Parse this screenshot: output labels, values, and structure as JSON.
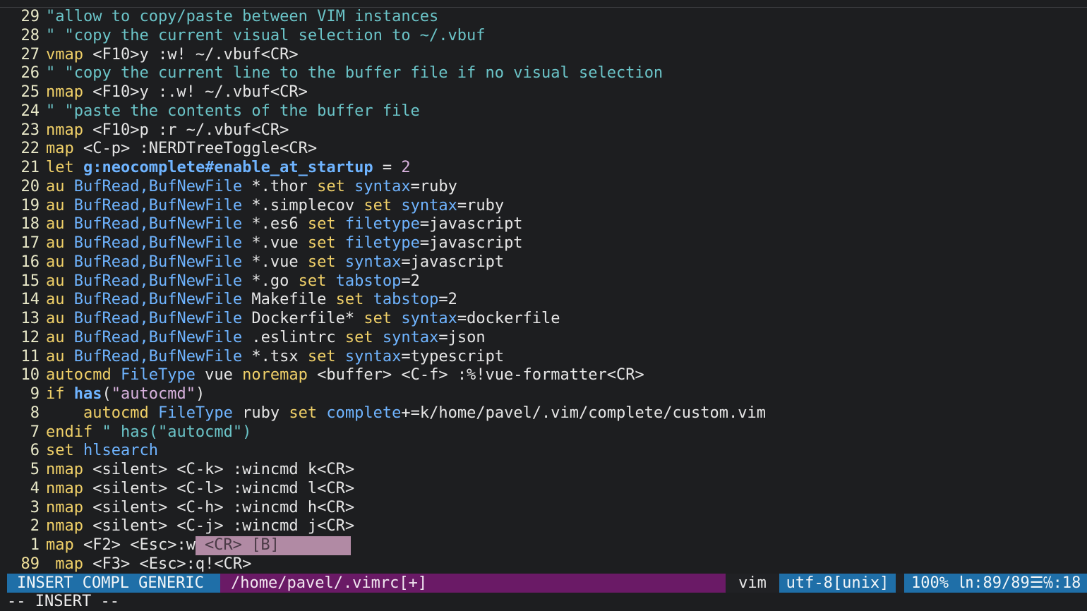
{
  "editor": {
    "lines": [
      {
        "num": "29",
        "segments": [
          {
            "t": "\"allow to copy/paste between VIM instances",
            "c": "t-comment"
          }
        ]
      },
      {
        "num": "28",
        "segments": [
          {
            "t": "\" \"copy the current visual selection to ~/.vbuf",
            "c": "t-comment"
          }
        ]
      },
      {
        "num": "27",
        "segments": [
          {
            "t": "vmap",
            "c": "t-kw"
          },
          {
            "t": " <F10>y :w! ~/.vbuf<CR>",
            "c": "t-plain"
          }
        ]
      },
      {
        "num": "26",
        "segments": [
          {
            "t": "\" \"copy the current line to the buffer file if no visual selection",
            "c": "t-comment"
          }
        ]
      },
      {
        "num": "25",
        "segments": [
          {
            "t": "nmap",
            "c": "t-kw"
          },
          {
            "t": " <F10>y :.w! ~/.vbuf<CR>",
            "c": "t-plain"
          }
        ]
      },
      {
        "num": "24",
        "segments": [
          {
            "t": "\" \"paste the contents of the buffer file",
            "c": "t-comment"
          }
        ]
      },
      {
        "num": "23",
        "segments": [
          {
            "t": "nmap",
            "c": "t-kw"
          },
          {
            "t": " <F10>p :r ~/.vbuf<CR>",
            "c": "t-plain"
          }
        ]
      },
      {
        "num": "22",
        "segments": [
          {
            "t": "map",
            "c": "t-kw"
          },
          {
            "t": " <C-p> :NERDTreeToggle<CR>",
            "c": "t-plain"
          }
        ]
      },
      {
        "num": "21",
        "segments": [
          {
            "t": "let",
            "c": "t-kw"
          },
          {
            "t": " ",
            "c": "t-plain"
          },
          {
            "t": "g:neocomplete#enable_at_startup",
            "c": "t-bold-blue"
          },
          {
            "t": " = ",
            "c": "t-plain"
          },
          {
            "t": "2",
            "c": "t-num"
          }
        ]
      },
      {
        "num": "20",
        "segments": [
          {
            "t": "au",
            "c": "t-kw"
          },
          {
            "t": " ",
            "c": "t-plain"
          },
          {
            "t": "BufRead,BufNewFile",
            "c": "t-var"
          },
          {
            "t": " *.thor ",
            "c": "t-plain"
          },
          {
            "t": "set",
            "c": "t-kw"
          },
          {
            "t": " ",
            "c": "t-plain"
          },
          {
            "t": "syntax",
            "c": "t-var"
          },
          {
            "t": "=ruby",
            "c": "t-plain"
          }
        ]
      },
      {
        "num": "19",
        "segments": [
          {
            "t": "au",
            "c": "t-kw"
          },
          {
            "t": " ",
            "c": "t-plain"
          },
          {
            "t": "BufRead,BufNewFile",
            "c": "t-var"
          },
          {
            "t": " *.simplecov ",
            "c": "t-plain"
          },
          {
            "t": "set",
            "c": "t-kw"
          },
          {
            "t": " ",
            "c": "t-plain"
          },
          {
            "t": "syntax",
            "c": "t-var"
          },
          {
            "t": "=ruby",
            "c": "t-plain"
          }
        ]
      },
      {
        "num": "18",
        "segments": [
          {
            "t": "au",
            "c": "t-kw"
          },
          {
            "t": " ",
            "c": "t-plain"
          },
          {
            "t": "BufRead,BufNewFile",
            "c": "t-var"
          },
          {
            "t": " *.es6 ",
            "c": "t-plain"
          },
          {
            "t": "set",
            "c": "t-kw"
          },
          {
            "t": " ",
            "c": "t-plain"
          },
          {
            "t": "filetype",
            "c": "t-var"
          },
          {
            "t": "=javascript",
            "c": "t-plain"
          }
        ]
      },
      {
        "num": "17",
        "segments": [
          {
            "t": "au",
            "c": "t-kw"
          },
          {
            "t": " ",
            "c": "t-plain"
          },
          {
            "t": "BufRead,BufNewFile",
            "c": "t-var"
          },
          {
            "t": " *.vue ",
            "c": "t-plain"
          },
          {
            "t": "set",
            "c": "t-kw"
          },
          {
            "t": " ",
            "c": "t-plain"
          },
          {
            "t": "filetype",
            "c": "t-var"
          },
          {
            "t": "=javascript",
            "c": "t-plain"
          }
        ]
      },
      {
        "num": "16",
        "segments": [
          {
            "t": "au",
            "c": "t-kw"
          },
          {
            "t": " ",
            "c": "t-plain"
          },
          {
            "t": "BufRead,BufNewFile",
            "c": "t-var"
          },
          {
            "t": " *.vue ",
            "c": "t-plain"
          },
          {
            "t": "set",
            "c": "t-kw"
          },
          {
            "t": " ",
            "c": "t-plain"
          },
          {
            "t": "syntax",
            "c": "t-var"
          },
          {
            "t": "=javascript",
            "c": "t-plain"
          }
        ]
      },
      {
        "num": "15",
        "segments": [
          {
            "t": "au",
            "c": "t-kw"
          },
          {
            "t": " ",
            "c": "t-plain"
          },
          {
            "t": "BufRead,BufNewFile",
            "c": "t-var"
          },
          {
            "t": " *.go ",
            "c": "t-plain"
          },
          {
            "t": "set",
            "c": "t-kw"
          },
          {
            "t": " ",
            "c": "t-plain"
          },
          {
            "t": "tabstop",
            "c": "t-var"
          },
          {
            "t": "=2",
            "c": "t-plain"
          }
        ]
      },
      {
        "num": "14",
        "segments": [
          {
            "t": "au",
            "c": "t-kw"
          },
          {
            "t": " ",
            "c": "t-plain"
          },
          {
            "t": "BufRead,BufNewFile",
            "c": "t-var"
          },
          {
            "t": " Makefile ",
            "c": "t-plain"
          },
          {
            "t": "set",
            "c": "t-kw"
          },
          {
            "t": " ",
            "c": "t-plain"
          },
          {
            "t": "tabstop",
            "c": "t-var"
          },
          {
            "t": "=2",
            "c": "t-plain"
          }
        ]
      },
      {
        "num": "13",
        "segments": [
          {
            "t": "au",
            "c": "t-kw"
          },
          {
            "t": " ",
            "c": "t-plain"
          },
          {
            "t": "BufRead,BufNewFile",
            "c": "t-var"
          },
          {
            "t": " Dockerfile* ",
            "c": "t-plain"
          },
          {
            "t": "set",
            "c": "t-kw"
          },
          {
            "t": " ",
            "c": "t-plain"
          },
          {
            "t": "syntax",
            "c": "t-var"
          },
          {
            "t": "=dockerfile",
            "c": "t-plain"
          }
        ]
      },
      {
        "num": "12",
        "segments": [
          {
            "t": "au",
            "c": "t-kw"
          },
          {
            "t": " ",
            "c": "t-plain"
          },
          {
            "t": "BufRead,BufNewFile",
            "c": "t-var"
          },
          {
            "t": " .eslintrc ",
            "c": "t-plain"
          },
          {
            "t": "set",
            "c": "t-kw"
          },
          {
            "t": " ",
            "c": "t-plain"
          },
          {
            "t": "syntax",
            "c": "t-var"
          },
          {
            "t": "=json",
            "c": "t-plain"
          }
        ]
      },
      {
        "num": "11",
        "segments": [
          {
            "t": "au",
            "c": "t-kw"
          },
          {
            "t": " ",
            "c": "t-plain"
          },
          {
            "t": "BufRead,BufNewFile",
            "c": "t-var"
          },
          {
            "t": " *.tsx ",
            "c": "t-plain"
          },
          {
            "t": "set",
            "c": "t-kw"
          },
          {
            "t": " ",
            "c": "t-plain"
          },
          {
            "t": "syntax",
            "c": "t-var"
          },
          {
            "t": "=typescript",
            "c": "t-plain"
          }
        ]
      },
      {
        "num": "10",
        "segments": [
          {
            "t": "autocmd",
            "c": "t-kw"
          },
          {
            "t": " ",
            "c": "t-plain"
          },
          {
            "t": "FileType",
            "c": "t-var"
          },
          {
            "t": " vue ",
            "c": "t-plain"
          },
          {
            "t": "noremap",
            "c": "t-kw"
          },
          {
            "t": " <buffer> <C-f> :%!vue-formatter<CR>",
            "c": "t-plain"
          }
        ]
      },
      {
        "num": "9",
        "segments": [
          {
            "t": "if",
            "c": "t-kw"
          },
          {
            "t": " ",
            "c": "t-plain"
          },
          {
            "t": "has",
            "c": "t-bold-blue"
          },
          {
            "t": "(",
            "c": "t-plain"
          },
          {
            "t": "\"autocmd\"",
            "c": "t-str"
          },
          {
            "t": ")",
            "c": "t-plain"
          }
        ]
      },
      {
        "num": "8",
        "segments": [
          {
            "t": "    ",
            "c": "t-plain"
          },
          {
            "t": "autocmd",
            "c": "t-kw"
          },
          {
            "t": " ",
            "c": "t-plain"
          },
          {
            "t": "FileType",
            "c": "t-var"
          },
          {
            "t": " ruby ",
            "c": "t-plain"
          },
          {
            "t": "set",
            "c": "t-kw"
          },
          {
            "t": " ",
            "c": "t-plain"
          },
          {
            "t": "complete",
            "c": "t-var"
          },
          {
            "t": "+=k/home/pavel/.vim/complete/custom.vim",
            "c": "t-plain"
          }
        ]
      },
      {
        "num": "7",
        "segments": [
          {
            "t": "endif",
            "c": "t-kw"
          },
          {
            "t": " \" has(\"autocmd\")",
            "c": "t-comment"
          }
        ]
      },
      {
        "num": "6",
        "segments": [
          {
            "t": "set",
            "c": "t-kw"
          },
          {
            "t": " ",
            "c": "t-plain"
          },
          {
            "t": "hlsearch",
            "c": "t-var"
          }
        ]
      },
      {
        "num": "5",
        "segments": [
          {
            "t": "nmap",
            "c": "t-kw"
          },
          {
            "t": " <silent> <C-k> :wincmd k<CR>",
            "c": "t-plain"
          }
        ]
      },
      {
        "num": "4",
        "segments": [
          {
            "t": "nmap",
            "c": "t-kw"
          },
          {
            "t": " <silent> <C-l> :wincmd l<CR>",
            "c": "t-plain"
          }
        ]
      },
      {
        "num": "3",
        "segments": [
          {
            "t": "nmap",
            "c": "t-kw"
          },
          {
            "t": " <silent> <C-h> :wincmd h<CR>",
            "c": "t-plain"
          }
        ]
      },
      {
        "num": "2",
        "segments": [
          {
            "t": "nmap",
            "c": "t-kw"
          },
          {
            "t": " <silent> <C-j> :wincmd j<CR>",
            "c": "t-plain"
          }
        ]
      },
      {
        "num": "1",
        "segments": [
          {
            "t": "map",
            "c": "t-kw"
          },
          {
            "t": " <F2> <Esc>:w",
            "c": "t-plain"
          }
        ],
        "popup": "<CR> [B]"
      },
      {
        "num": "89",
        "current": true,
        "segments": [
          {
            "t": " map",
            "c": "t-kw"
          },
          {
            "t": " <F3> <Esc>:q!<CR>",
            "c": "t-plain"
          }
        ]
      }
    ]
  },
  "statusbar": {
    "mode": "INSERT COMPL GENERIC",
    "file": "/home/pavel/.vimrc[+]",
    "filetype": "vim",
    "encoding": "utf-8[unix]",
    "position": "100% ㏑:89/89☰℅:18"
  },
  "cmdline": {
    "text": "-- INSERT --"
  },
  "colors": {
    "background": "#1d1e20",
    "comment": "#6bc4c8",
    "keyword": "#f0d068",
    "identifier": "#6fb4ff",
    "mode_bg": "#1f6fa8",
    "file_bg": "#6a1a66",
    "popup_bg": "#b18aa4"
  }
}
